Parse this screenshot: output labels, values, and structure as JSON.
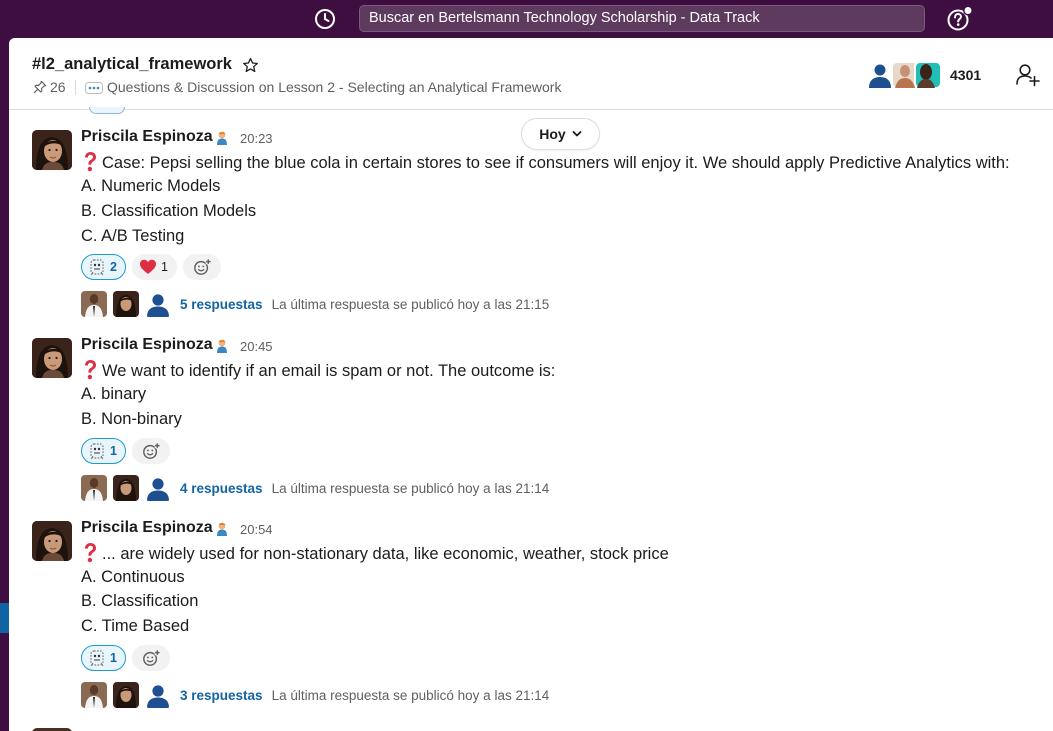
{
  "topbar": {
    "search_text": "Buscar en Bertelsmann Technology Scholarship - Data Track"
  },
  "channel": {
    "name": "#l2_analytical_framework",
    "pinned_count": "26",
    "topic": "Questions & Discussion on Lesson 2 - Selecting an Analytical Framework",
    "member_count": "4301"
  },
  "day_divider": "Hoy",
  "messages": [
    {
      "sender": "Priscila Espinoza",
      "time": "20:23",
      "question": "Case: Pepsi selling the blue cola in certain stores to see if consumers will enjoy it. We should apply Predictive Analytics with:",
      "options": [
        "A. Numeric Models",
        "B. Classification Models",
        "C. A/B Testing"
      ],
      "reactions": [
        {
          "emoji": "custom-parrot-icon",
          "count": "2"
        },
        {
          "emoji": "heart-icon",
          "count": "1"
        }
      ],
      "replies": "5 respuestas",
      "last_reply": "La última respuesta se publicó hoy a las 21:15"
    },
    {
      "sender": "Priscila Espinoza",
      "time": "20:45",
      "question": "We want to identify if an email is spam or not. The outcome is:",
      "options": [
        "A. binary",
        "B. Non-binary"
      ],
      "reactions": [
        {
          "emoji": "custom-parrot-icon",
          "count": "1"
        }
      ],
      "replies": "4 respuestas",
      "last_reply": "La última respuesta se publicó hoy a las 21:14"
    },
    {
      "sender": "Priscila Espinoza",
      "time": "20:54",
      "question": "... are widely used for non-stationary data, like economic, weather, stock price",
      "options": [
        "A. Continuous",
        "B. Classification",
        "C. Time Based"
      ],
      "reactions": [
        {
          "emoji": "custom-parrot-icon",
          "count": "1"
        }
      ],
      "replies": "3 respuestas",
      "last_reply": "La última respuesta se publicó hoy a las 21:14"
    }
  ],
  "colors": {
    "sidebar": "#3f0e40",
    "link": "#1264a3",
    "reaction_own_bg": "#e8f5fa",
    "question_mark": "#dd2e44"
  }
}
